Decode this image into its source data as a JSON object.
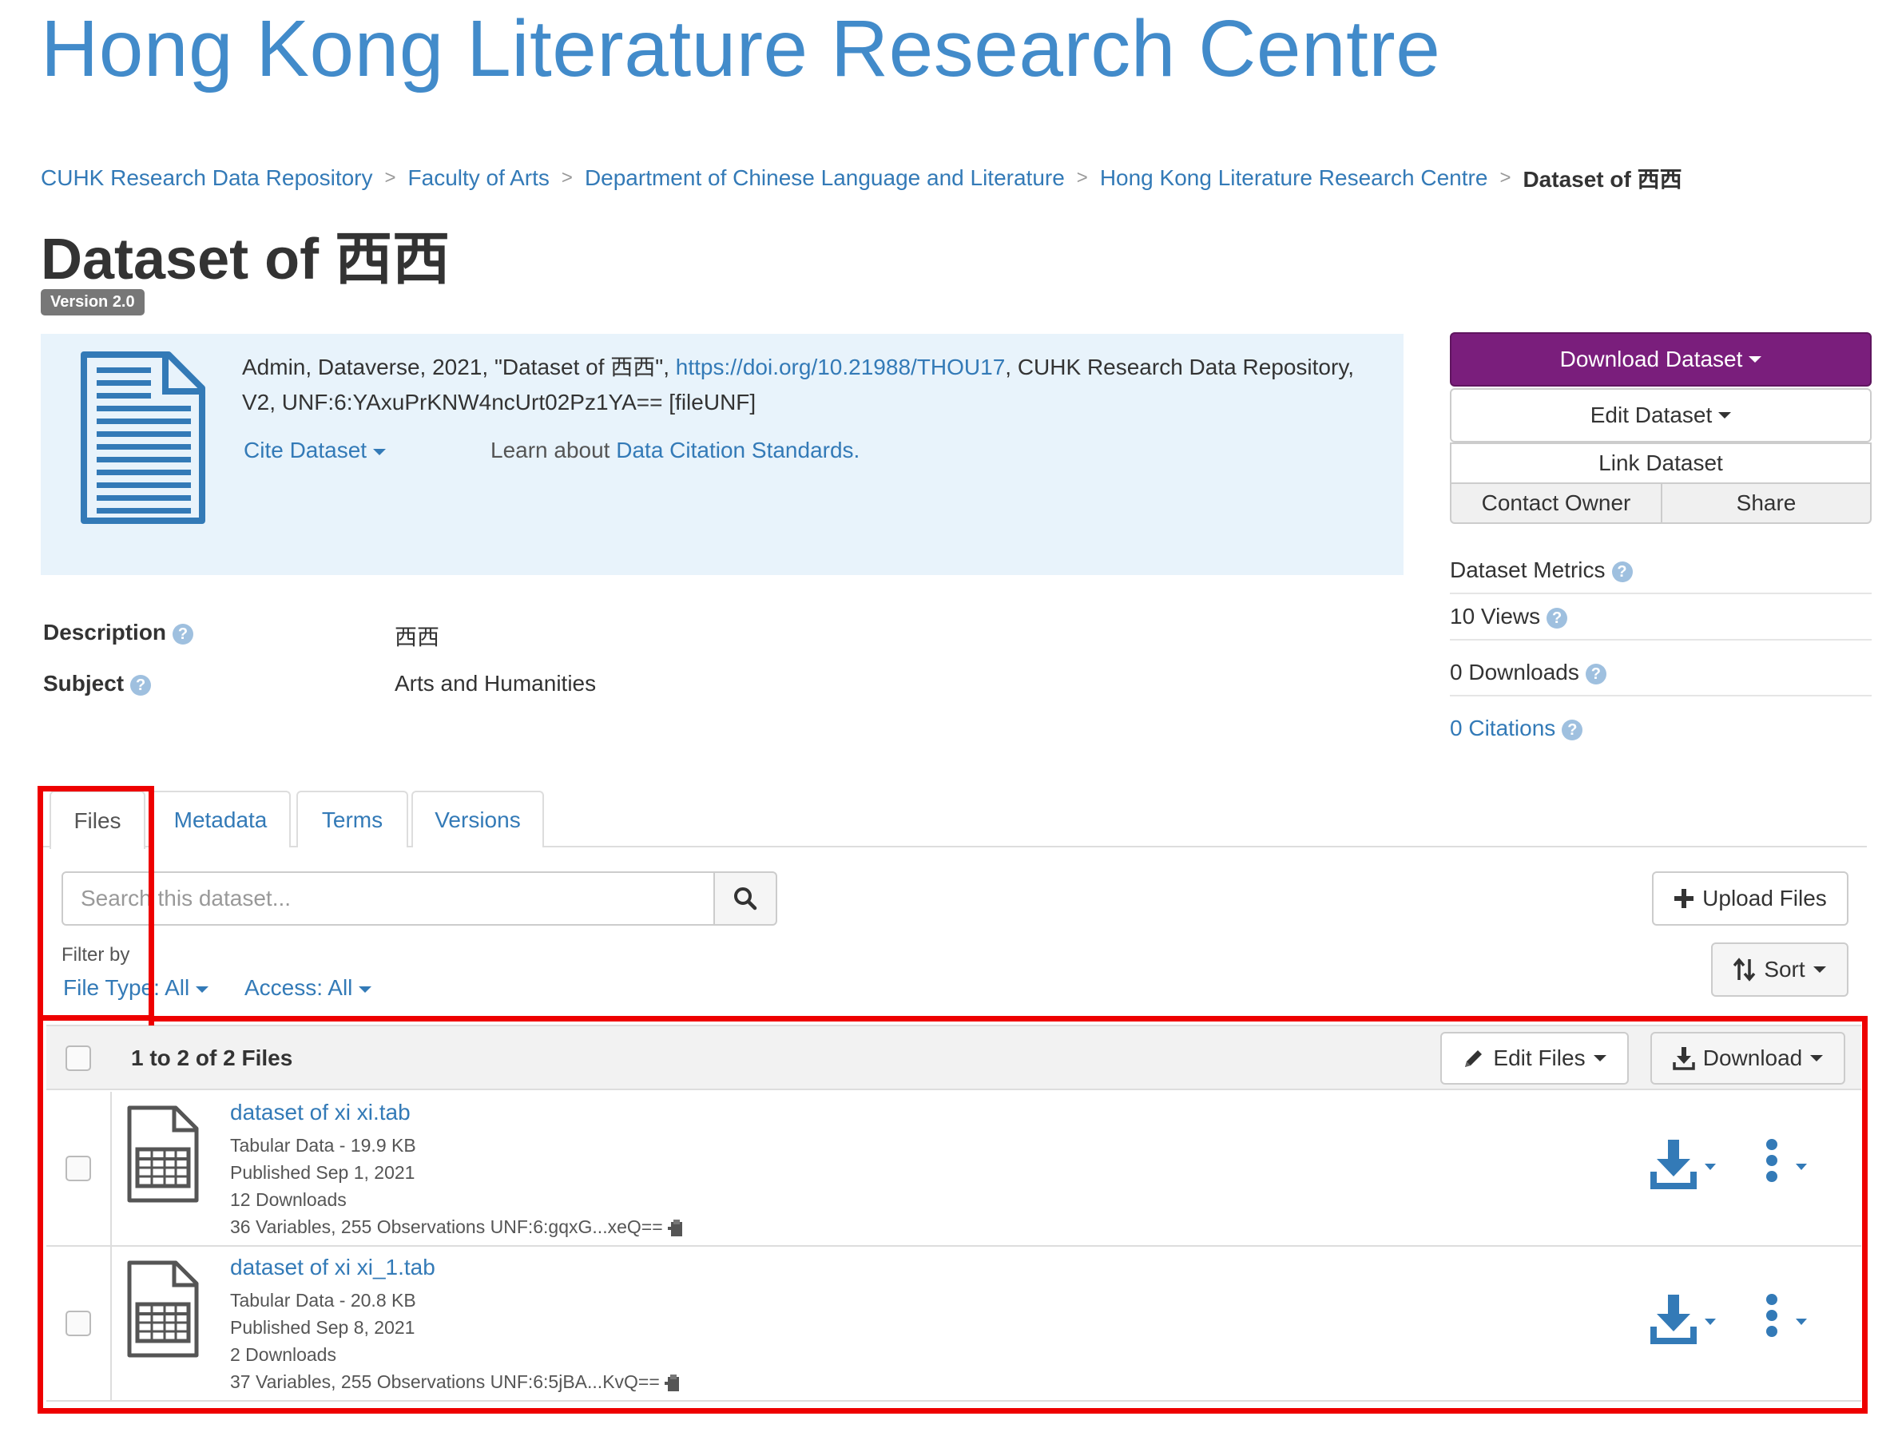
{
  "header": {
    "site_title": "Hong Kong Literature Research Centre"
  },
  "breadcrumb": {
    "items": [
      "CUHK Research Data Repository",
      "Faculty of Arts",
      "Department of Chinese Language and Literature",
      "Hong Kong Literature Research Centre"
    ],
    "current": "Dataset of 西西",
    "separator": ">"
  },
  "dataset": {
    "title": "Dataset of 西西",
    "version": "Version 2.0"
  },
  "citation": {
    "text_before": "Admin, Dataverse, 2021, \"Dataset of 西西\", ",
    "doi": "https://doi.org/10.21988/THOU17",
    "text_after": ", CUHK Research Data Repository, V2, UNF:6:YAxuPrKNW4ncUrt02Pz1YA== [fileUNF]",
    "cite_button": "Cite Dataset",
    "learn_prefix": "Learn about ",
    "learn_link": "Data Citation Standards."
  },
  "actions": {
    "download_dataset": "Download Dataset",
    "edit_dataset": "Edit Dataset",
    "link_dataset": "Link Dataset",
    "contact_owner": "Contact Owner",
    "share": "Share"
  },
  "metrics": {
    "title": "Dataset Metrics",
    "views": "10 Views",
    "downloads": "0 Downloads",
    "citations": "0 Citations"
  },
  "metadata_summary": {
    "description_label": "Description",
    "description_value": "西西",
    "subject_label": "Subject",
    "subject_value": "Arts and Humanities"
  },
  "tabs": [
    "Files",
    "Metadata",
    "Terms",
    "Versions"
  ],
  "search": {
    "placeholder": "Search this dataset..."
  },
  "upload_button": "Upload Files",
  "sort_button": "Sort",
  "filter": {
    "label": "Filter by",
    "file_type": "File Type: All",
    "access": "Access: All"
  },
  "files_table": {
    "count_label": "1 to 2 of 2 Files",
    "edit_files": "Edit Files",
    "download": "Download",
    "rows": [
      {
        "name": "dataset of xi xi.tab",
        "type_size": "Tabular Data - 19.9 KB",
        "published": "Published Sep 1, 2021",
        "downloads": "12 Downloads",
        "unf": "36 Variables, 255 Observations UNF:6:gqxG...xeQ=="
      },
      {
        "name": "dataset of xi xi_1.tab",
        "type_size": "Tabular Data - 20.8 KB",
        "published": "Published Sep 8, 2021",
        "downloads": "2 Downloads",
        "unf": "37 Variables, 255 Observations UNF:6:5jBA...KvQ=="
      }
    ]
  },
  "colors": {
    "link": "#337ab7",
    "title": "#428bca",
    "download_dataset_bg": "#7a1e7c",
    "annotation_red": "#ee0000",
    "citation_bg": "#e8f3fb"
  },
  "icons": {
    "document": "document-icon",
    "search": "search-icon",
    "plus": "plus-icon",
    "sort": "sort-icon",
    "pencil": "pencil-icon",
    "download": "download-icon",
    "table_file": "table-file-icon",
    "more": "more-vertical-icon",
    "help": "help-icon",
    "clipboard": "clipboard-icon"
  }
}
